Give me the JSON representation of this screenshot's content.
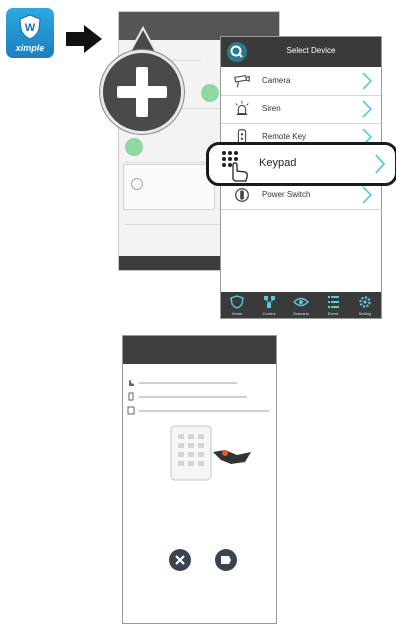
{
  "app": {
    "brand": "ximple",
    "icon": "w2-shield-icon"
  },
  "select_device": {
    "title": "Select Device",
    "items": [
      {
        "label": "Camera",
        "icon": "camera-icon"
      },
      {
        "label": "Siren",
        "icon": "siren-icon"
      },
      {
        "label": "Remote Key",
        "icon": "remote-key-icon"
      },
      {
        "label": "Power Switch",
        "icon": "power-switch-icon"
      }
    ],
    "highlight": {
      "label": "Keypad",
      "icon": "keypad-icon"
    },
    "tabs": [
      {
        "label": "Home",
        "icon": "shield-icon"
      },
      {
        "label": "Control",
        "icon": "network-icon"
      },
      {
        "label": "Scenario",
        "icon": "eye-icon"
      },
      {
        "label": "Event",
        "icon": "list-icon"
      },
      {
        "label": "Setting",
        "icon": "gear-icon"
      }
    ]
  },
  "colors": {
    "accent": "#5bc8dc",
    "highlight": "#1a1a1a",
    "dark": "#3a3a3a"
  }
}
